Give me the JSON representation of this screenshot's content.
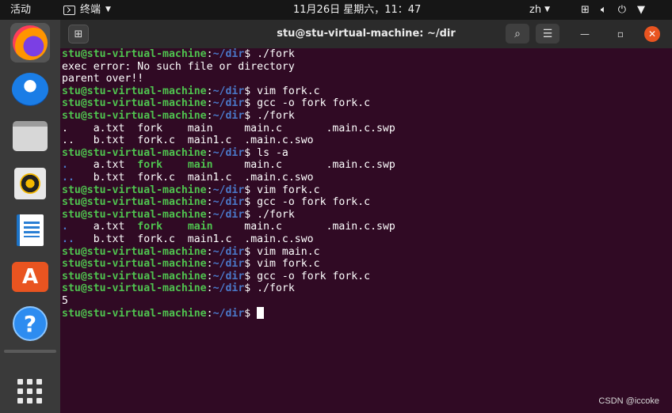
{
  "topbar": {
    "activities": "活动",
    "app_name": "终端",
    "clock": "11月26日 星期六，11：47",
    "lang": "zh"
  },
  "window": {
    "title": "stu@stu-virtual-machine: ~/dir"
  },
  "prompt": {
    "user": "stu@stu-virtual-machine",
    "colon": ":",
    "path": "~/dir",
    "sign": "$"
  },
  "terminal": {
    "lines": [
      {
        "type": "cmd",
        "cmd": " ./fork"
      },
      {
        "type": "out",
        "text": "exec error: No such file or directory"
      },
      {
        "type": "out",
        "text": "parent over!!"
      },
      {
        "type": "cmd",
        "cmd": " vim fork.c"
      },
      {
        "type": "cmd",
        "cmd": " gcc -o fork fork.c"
      },
      {
        "type": "cmd",
        "cmd": " ./fork"
      },
      {
        "type": "out",
        "text": ".    a.txt  fork    main     main.c       .main.c.swp"
      },
      {
        "type": "out",
        "text": "..   b.txt  fork.c  main1.c  .main.c.swo"
      },
      {
        "type": "cmd",
        "cmd": " ls -a"
      },
      {
        "type": "ls1",
        "cells": [
          ".",
          "    a.txt  ",
          "fork",
          "    ",
          "main",
          "     main.c       .main.c.swp"
        ]
      },
      {
        "type": "ls2",
        "cells": [
          "..",
          "   b.txt  fork.c  main1.c  .main.c.swo"
        ]
      },
      {
        "type": "cmd",
        "cmd": " vim fork.c"
      },
      {
        "type": "cmd",
        "cmd": " gcc -o fork fork.c"
      },
      {
        "type": "cmd",
        "cmd": " ./fork"
      },
      {
        "type": "ls1",
        "cells": [
          ".",
          "    a.txt  ",
          "fork",
          "    ",
          "main",
          "     main.c       .main.c.swp"
        ]
      },
      {
        "type": "ls2",
        "cells": [
          "..",
          "   b.txt  fork.c  main1.c  .main.c.swo"
        ]
      },
      {
        "type": "cmd",
        "cmd": " vim main.c"
      },
      {
        "type": "cmd",
        "cmd": " vim fork.c"
      },
      {
        "type": "cmd",
        "cmd": " gcc -o fork fork.c"
      },
      {
        "type": "cmd",
        "cmd": " ./fork"
      },
      {
        "type": "out",
        "text": "5"
      },
      {
        "type": "cur",
        "cmd": " "
      }
    ]
  },
  "watermark": "CSDN @iccoke",
  "dock_icons": [
    "firefox-icon",
    "thunderbird-icon",
    "files-icon",
    "rhythmbox-icon",
    "writer-icon",
    "software-store-icon",
    "help-icon",
    "show-apps-icon"
  ]
}
